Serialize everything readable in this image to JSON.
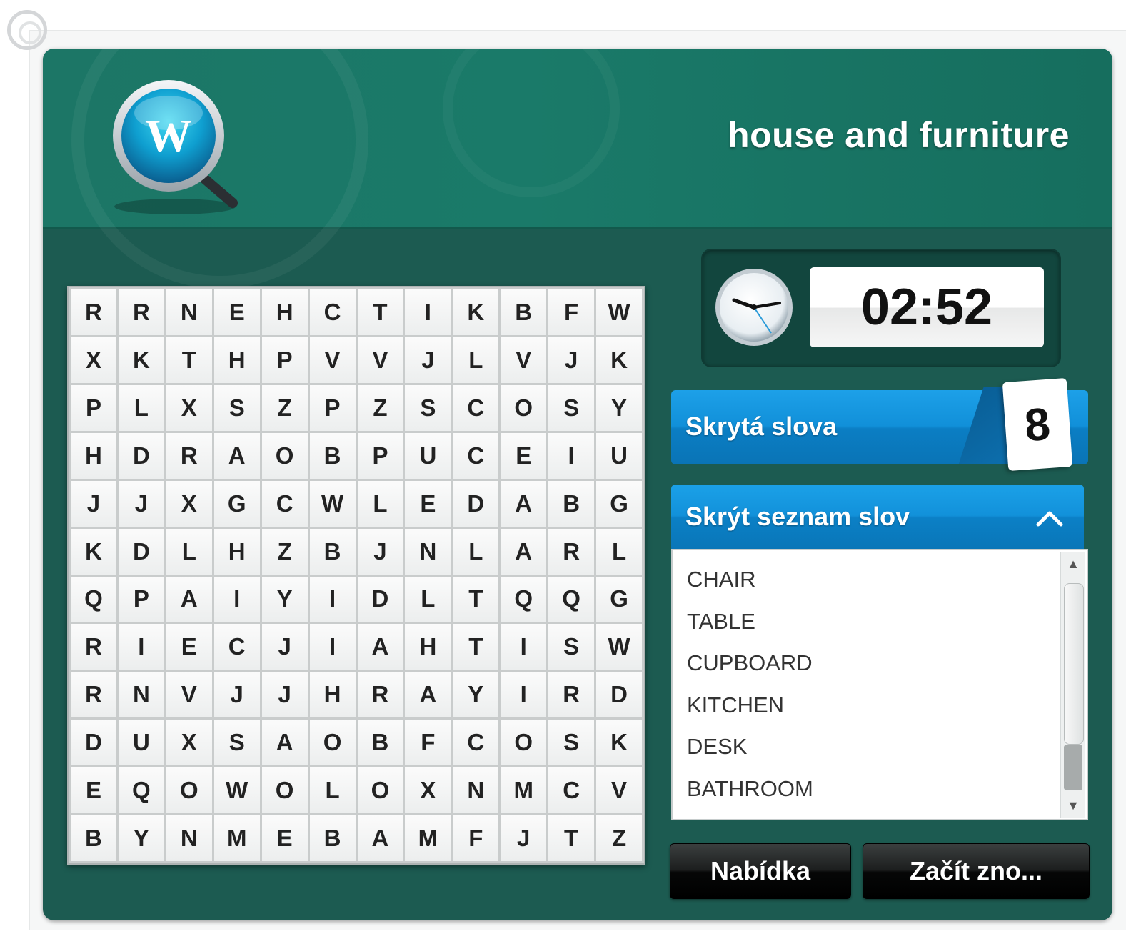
{
  "title": "house and furniture",
  "logo_letter": "W",
  "timer": "02:52",
  "hidden_words_label": "Skrytá slova",
  "hidden_words_count": "8",
  "word_list_toggle_label": "Skrýt seznam slov",
  "words": [
    "CHAIR",
    "TABLE",
    "CUPBOARD",
    "KITCHEN",
    "DESK",
    "BATHROOM"
  ],
  "buttons": {
    "menu": "Nabídka",
    "restart": "Začít zno..."
  },
  "grid": [
    [
      "R",
      "R",
      "N",
      "E",
      "H",
      "C",
      "T",
      "I",
      "K",
      "B",
      "F",
      "W"
    ],
    [
      "X",
      "K",
      "T",
      "H",
      "P",
      "V",
      "V",
      "J",
      "L",
      "V",
      "J",
      "K"
    ],
    [
      "P",
      "L",
      "X",
      "S",
      "Z",
      "P",
      "Z",
      "S",
      "C",
      "O",
      "S",
      "Y"
    ],
    [
      "H",
      "D",
      "R",
      "A",
      "O",
      "B",
      "P",
      "U",
      "C",
      "E",
      "I",
      "U"
    ],
    [
      "J",
      "J",
      "X",
      "G",
      "C",
      "W",
      "L",
      "E",
      "D",
      "A",
      "B",
      "G"
    ],
    [
      "K",
      "D",
      "L",
      "H",
      "Z",
      "B",
      "J",
      "N",
      "L",
      "A",
      "R",
      "L"
    ],
    [
      "Q",
      "P",
      "A",
      "I",
      "Y",
      "I",
      "D",
      "L",
      "T",
      "Q",
      "Q",
      "G"
    ],
    [
      "R",
      "I",
      "E",
      "C",
      "J",
      "I",
      "A",
      "H",
      "T",
      "I",
      "S",
      "W"
    ],
    [
      "R",
      "N",
      "V",
      "J",
      "J",
      "H",
      "R",
      "A",
      "Y",
      "I",
      "R",
      "D"
    ],
    [
      "D",
      "U",
      "X",
      "S",
      "A",
      "O",
      "B",
      "F",
      "C",
      "O",
      "S",
      "K"
    ],
    [
      "E",
      "Q",
      "O",
      "W",
      "O",
      "L",
      "O",
      "X",
      "N",
      "M",
      "C",
      "V"
    ],
    [
      "B",
      "Y",
      "N",
      "M",
      "E",
      "B",
      "A",
      "M",
      "F",
      "J",
      "T",
      "Z"
    ]
  ],
  "colors": {
    "header": "#1a7a69",
    "panel": "#1c5b51",
    "accent_blue": "#1190d9",
    "button_dark": "#1c1e1e"
  }
}
